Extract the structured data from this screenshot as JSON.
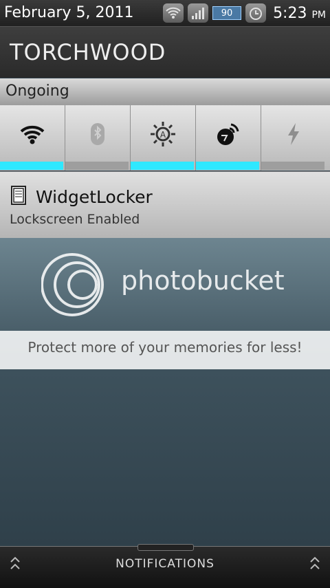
{
  "status_bar": {
    "date": "February 5, 2011",
    "battery": "90",
    "time": "5:23",
    "ampm": "PM",
    "icons": [
      "wifi-icon",
      "signal-icon",
      "battery-icon",
      "alarm-icon"
    ]
  },
  "carrier": {
    "name": "TORCHWOOD"
  },
  "section": {
    "title": "Ongoing"
  },
  "toggles": [
    {
      "icon": "wifi-icon",
      "enabled": true
    },
    {
      "icon": "bluetooth-icon",
      "enabled": false
    },
    {
      "icon": "brightness-icon",
      "enabled": true
    },
    {
      "icon": "sync-icon",
      "enabled": true
    },
    {
      "icon": "flashlight-icon",
      "enabled": false
    }
  ],
  "notification": {
    "app": "WidgetLocker",
    "status": "Lockscreen Enabled",
    "icon": "widgetlocker-icon"
  },
  "wallpaper": {
    "watermark": "photobucket",
    "banner": "Protect more of your memories for less!"
  },
  "bottom_bar": {
    "label": "NOTIFICATIONS"
  },
  "colors": {
    "toggle_on": "#2fe8ff",
    "toggle_off": "#9e9e9e"
  }
}
